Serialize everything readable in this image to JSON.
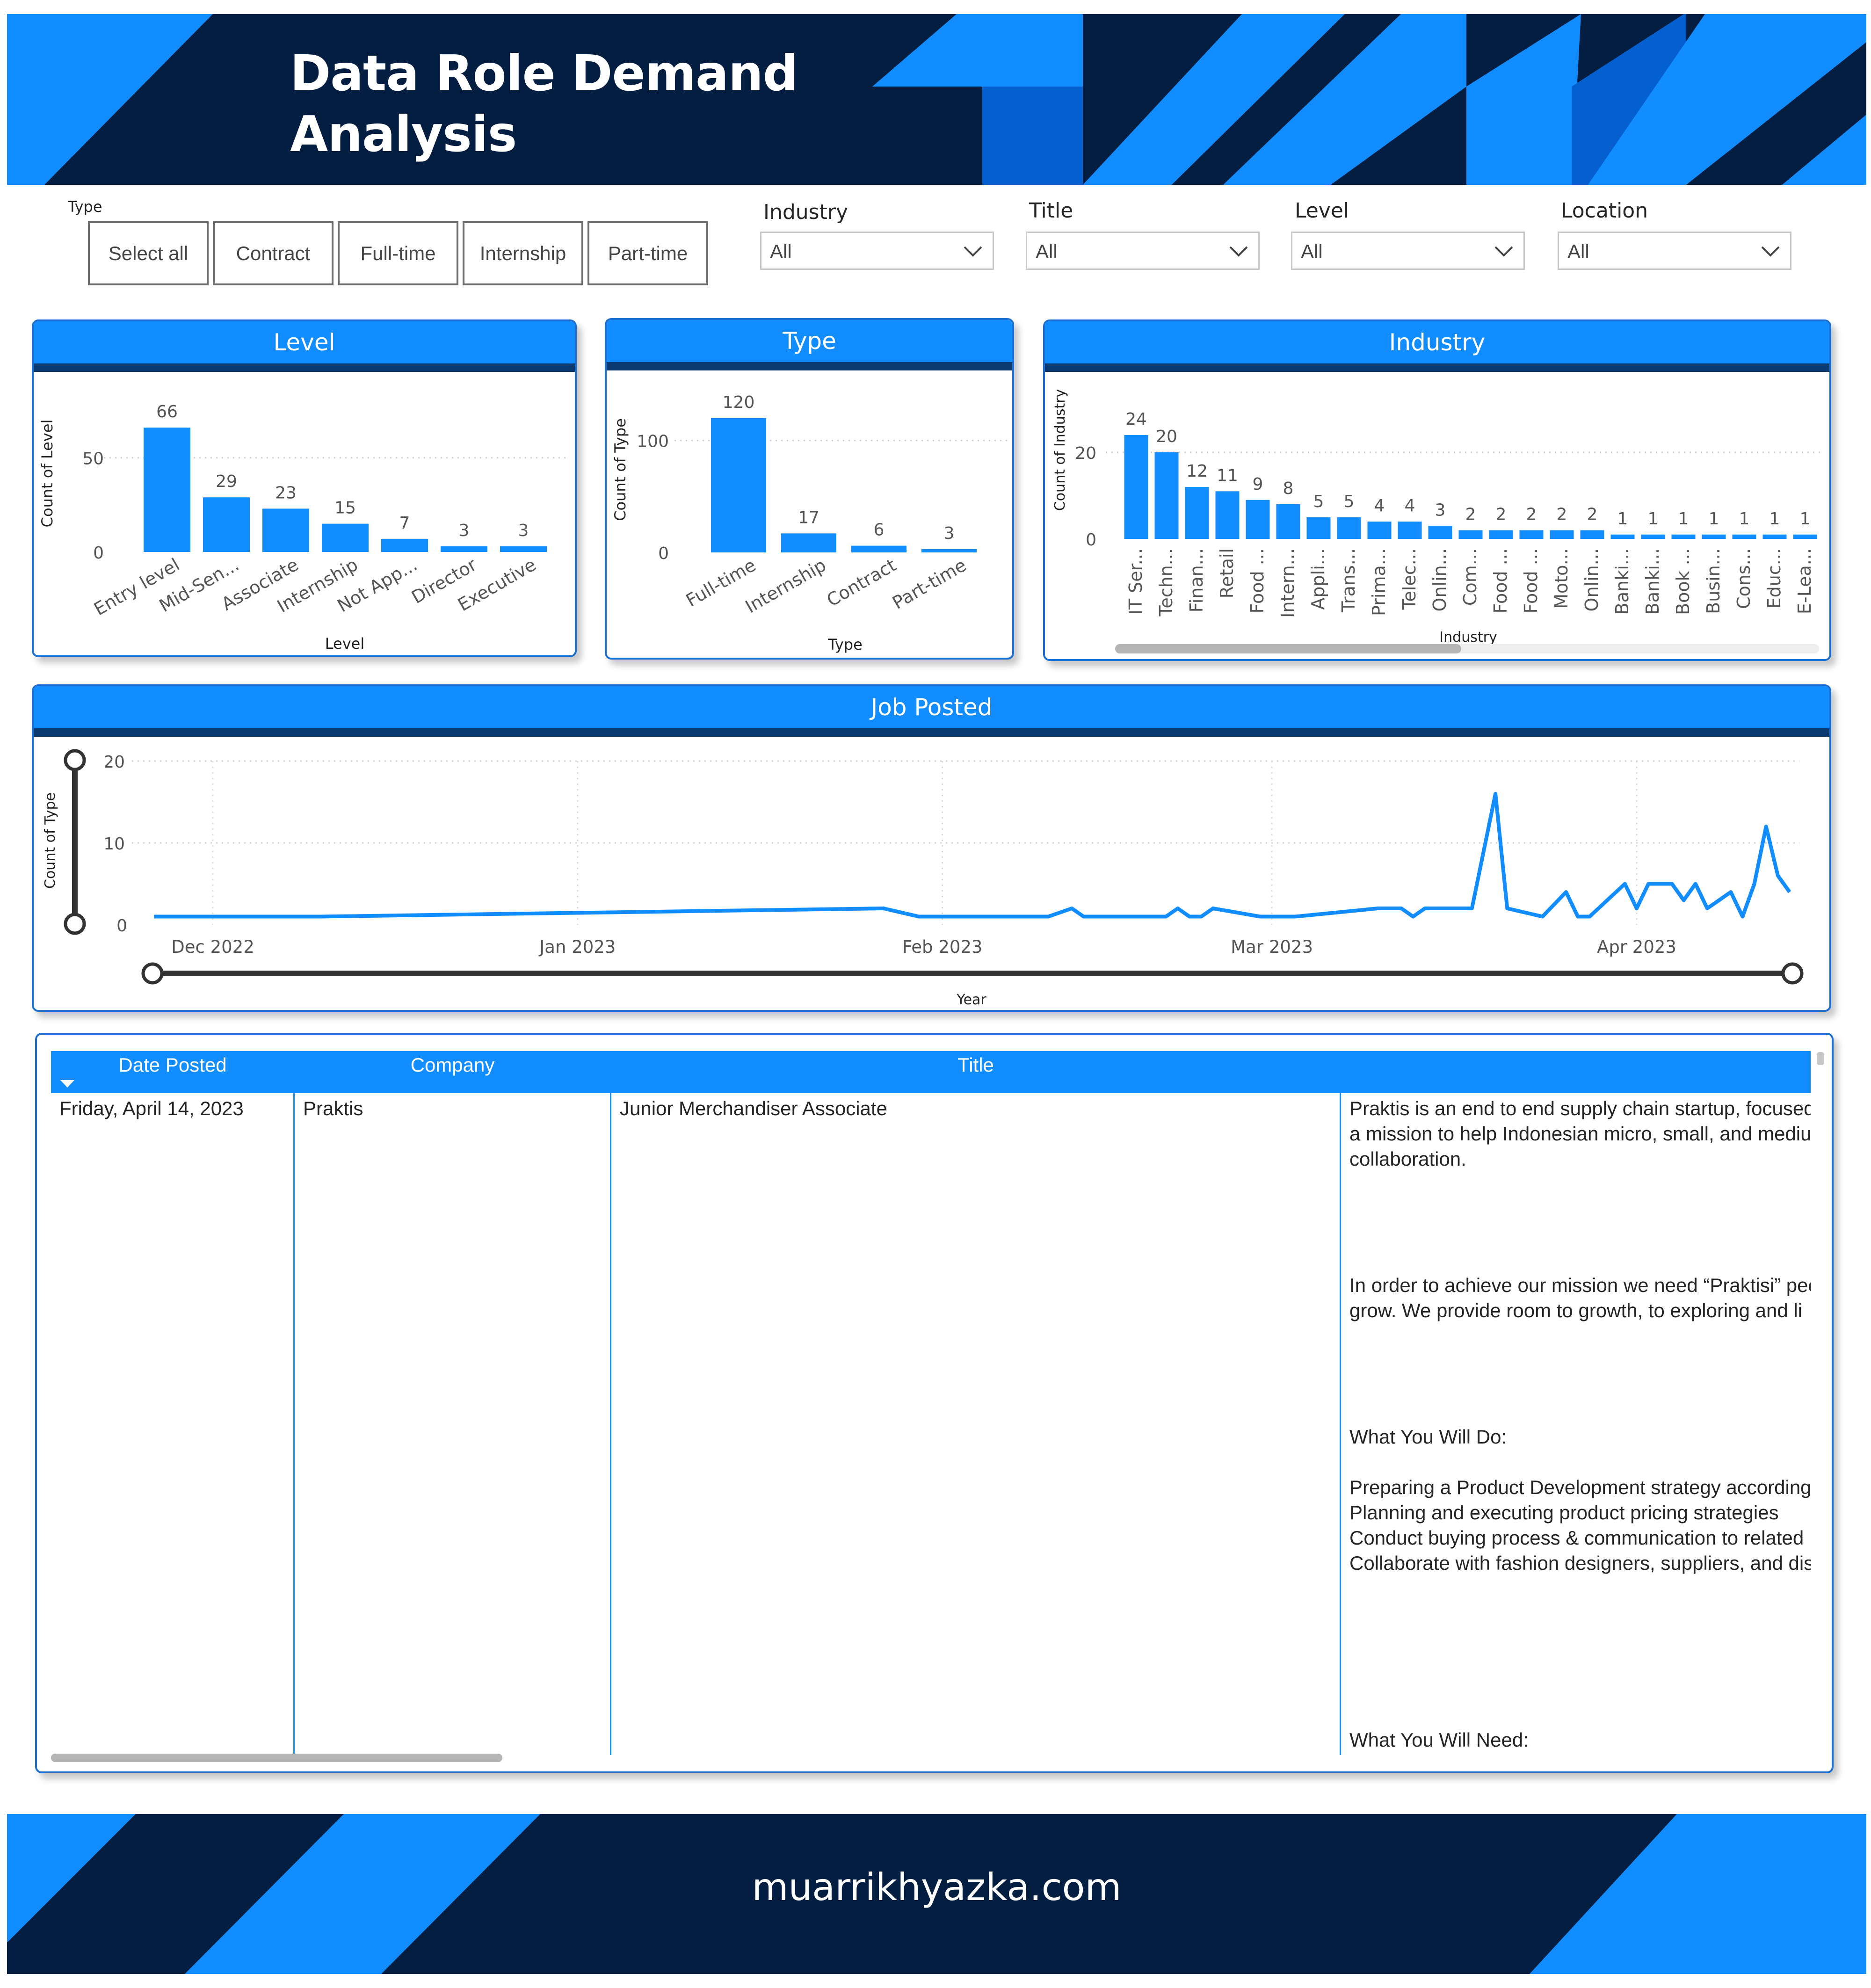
{
  "header": {
    "title_line1": "Data Role Demand",
    "title_line2": "Analysis",
    "colors": {
      "navy": "#041e42",
      "blue": "#118dff",
      "mid_blue": "#0560cf"
    }
  },
  "filters": {
    "type": {
      "label": "Type",
      "options": [
        "Select all",
        "Contract",
        "Full-time",
        "Internship",
        "Part-time"
      ]
    },
    "industry": {
      "label": "Industry",
      "value": "All"
    },
    "title": {
      "label": "Title",
      "value": "All"
    },
    "level": {
      "label": "Level",
      "value": "All"
    },
    "location": {
      "label": "Location",
      "value": "All"
    }
  },
  "cards": {
    "level": "Level",
    "type": "Type",
    "industry": "Industry",
    "job_posted": "Job Posted"
  },
  "chart_data": [
    {
      "type": "bar",
      "title": "Level",
      "xlabel": "Level",
      "ylabel": "Count of Level",
      "categories": [
        "Entry level",
        "Mid-Sen...",
        "Associate",
        "Internship",
        "Not App...",
        "Director",
        "Executive"
      ],
      "values": [
        66,
        29,
        23,
        15,
        7,
        3,
        3
      ],
      "yticks": [
        0,
        50
      ],
      "ylim": [
        0,
        75
      ],
      "grid": true
    },
    {
      "type": "bar",
      "title": "Type",
      "xlabel": "Type",
      "ylabel": "Count of Type",
      "categories": [
        "Full-time",
        "Internship",
        "Contract",
        "Part-time"
      ],
      "values": [
        120,
        17,
        6,
        3
      ],
      "yticks": [
        0,
        100
      ],
      "ylim": [
        0,
        140
      ],
      "grid": true
    },
    {
      "type": "bar",
      "title": "Industry",
      "xlabel": "Industry",
      "ylabel": "Count of Industry",
      "categories": [
        "IT Ser...",
        "Techn...",
        "Finan...",
        "Retail",
        "Food ...",
        "Intern...",
        "Appli...",
        "Trans...",
        "Prima...",
        "Telec...",
        "Onlin...",
        "Com...",
        "Food ...",
        "Food ...",
        "Moto...",
        "Onlin...",
        "Banki...",
        "Banki...",
        "Book ...",
        "Busin...",
        "Cons...",
        "Educ...",
        "E-Lea..."
      ],
      "values": [
        24,
        20,
        12,
        11,
        9,
        8,
        5,
        5,
        4,
        4,
        3,
        2,
        2,
        2,
        2,
        2,
        1,
        1,
        1,
        1,
        1,
        1,
        1
      ],
      "yticks": [
        0,
        20
      ],
      "ylim": [
        0,
        28
      ],
      "grid": true
    },
    {
      "type": "line",
      "title": "Job Posted",
      "xlabel": "Year",
      "ylabel": "Count of Type",
      "xticks": [
        "Dec 2022",
        "Jan 2023",
        "Feb 2023",
        "Mar 2023",
        "Apr 2023"
      ],
      "x": [
        "2022-11-26",
        "2022-12-10",
        "2023-01-27",
        "2023-01-30",
        "2023-02-10",
        "2023-02-12",
        "2023-02-13",
        "2023-02-20",
        "2023-02-21",
        "2023-02-22",
        "2023-02-23",
        "2023-02-24",
        "2023-02-28",
        "2023-03-03",
        "2023-03-10",
        "2023-03-12",
        "2023-03-13",
        "2023-03-14",
        "2023-03-18",
        "2023-03-20",
        "2023-03-21",
        "2023-03-24",
        "2023-03-26",
        "2023-03-27",
        "2023-03-28",
        "2023-03-31",
        "2023-04-01",
        "2023-04-02",
        "2023-04-04",
        "2023-04-05",
        "2023-04-06",
        "2023-04-07",
        "2023-04-09",
        "2023-04-10",
        "2023-04-11",
        "2023-04-12",
        "2023-04-13",
        "2023-04-14"
      ],
      "values": [
        1,
        1,
        2,
        1,
        1,
        2,
        1,
        1,
        2,
        1,
        1,
        2,
        1,
        1,
        2,
        2,
        1,
        2,
        2,
        16,
        2,
        1,
        4,
        1,
        1,
        5,
        2,
        5,
        5,
        3,
        5,
        2,
        4,
        1,
        5,
        12,
        6,
        4
      ],
      "yticks": [
        0,
        10,
        20
      ],
      "ylim": [
        0,
        20
      ],
      "grid": true
    }
  ],
  "table": {
    "columns": [
      "Date Posted",
      "Company",
      "Title",
      ""
    ],
    "rows": [
      {
        "date_posted": "Friday, April 14, 2023",
        "company": "Praktis",
        "title": "Junior Merchandiser Associate",
        "description": "Praktis is an end to end supply chain startup, focused\na mission to help Indonesian micro, small, and mediur\ncollaboration.\n\n\n\n\nIn order to achieve our mission we need “Praktisi” pec\ngrow. We provide room to growth, to exploring and li\n\n\n\n\nWhat You Will Do:\n\nPreparing a Product Development strategy according\nPlanning and executing product pricing strategies\nConduct buying process & communication to related\nCollaborate with fashion designers, suppliers, and dist\n\n\n\n\n\n\nWhat You Will Need:"
      }
    ]
  },
  "footer": {
    "text": "muarrikhyazka.com"
  }
}
